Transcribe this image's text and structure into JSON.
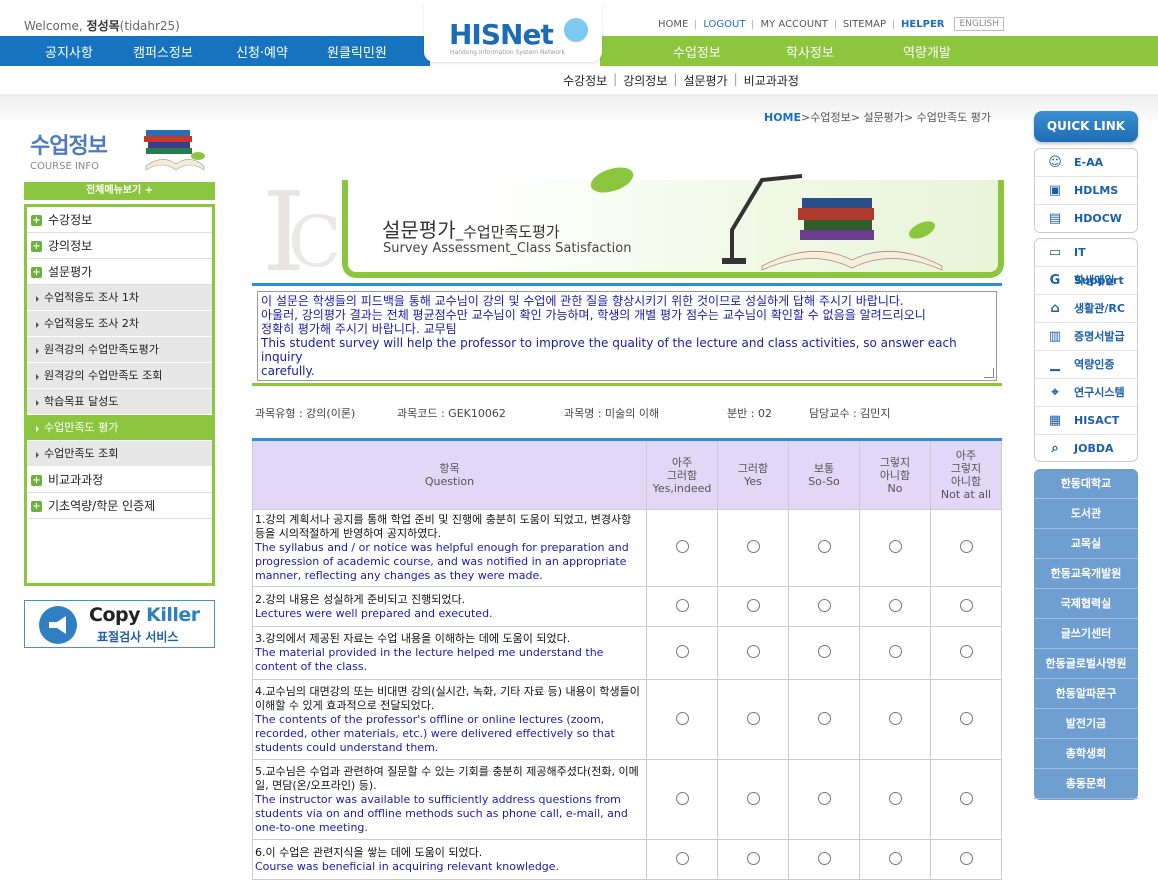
{
  "header": {
    "welcome_prefix": "Welcome,",
    "user_name": "정성목",
    "user_id": "(tidahr25)",
    "logo_text_a": "HIS",
    "logo_text_b": "Net",
    "logo_sub": "Handong Information System Network",
    "links": {
      "home": "HOME",
      "logout": "LOGOUT",
      "account": "MY ACCOUNT",
      "sitemap": "SITEMAP",
      "helper": "HELPER",
      "english": "ENGLISH"
    }
  },
  "nav": {
    "left": [
      "공지사항",
      "캠퍼스정보",
      "신청·예약",
      "원클릭민원"
    ],
    "right": [
      "수업정보",
      "학사정보",
      "역량개발"
    ],
    "sub": [
      "수강정보",
      "강의정보",
      "설문평가",
      "비교과과정"
    ]
  },
  "sidebar": {
    "title": "수업정보",
    "title_en": "COURSE INFO",
    "all_menu": "전체메뉴보기 +",
    "items": [
      {
        "label": "수강정보",
        "type": "top"
      },
      {
        "label": "강의정보",
        "type": "top"
      },
      {
        "label": "설문평가",
        "type": "top"
      },
      {
        "label": "수업적응도 조사 1차",
        "type": "sub"
      },
      {
        "label": "수업적응도 조사 2차",
        "type": "sub"
      },
      {
        "label": "원격강의 수업만족도평가",
        "type": "sub"
      },
      {
        "label": "원격강의 수업만족도 조회",
        "type": "sub"
      },
      {
        "label": "학습목표 달성도",
        "type": "sub"
      },
      {
        "label": "수업만족도 평가",
        "type": "sub",
        "active": true
      },
      {
        "label": "수업만족도 조회",
        "type": "sub"
      },
      {
        "label": "비교과과정",
        "type": "top"
      },
      {
        "label": "기초역량/학문 인증제",
        "type": "top"
      }
    ],
    "copykiller": {
      "title_a": "Copy ",
      "title_b": "Killer",
      "subtitle": "표절검사 서비스"
    }
  },
  "breadcrumb": {
    "home": "HOME",
    "path": ">수업정보> 설문평가> 수업만족도 평가"
  },
  "banner": {
    "title": "설문평가",
    "title_small": "_수업만족도평가",
    "subtitle": "Survey Assessment_Class Satisfaction"
  },
  "notice": {
    "lines": [
      "이 설문은 학생들의 피드백을 통해 교수님이 강의 및 수업에 관한 질을 향상시키기 위한 것이므로 성실하게 답해 주시기 바랍니다.",
      "아울러, 강의평가 결과는 전체 평균점수만 교수님이 확인 가능하며, 학생의 개별 평가 점수는 교수님이 확인할 수 없음을 알려드리오니",
      "정확히 평가해 주시기 바랍니다. 교무팀",
      "This student survey will help the professor to improve the quality of the lecture and class activities, so answer each inquiry",
      "carefully."
    ]
  },
  "course": {
    "type": "과목유형 : 강의(이론)",
    "code": "과목코드 : GEK10062",
    "name": "과목명 : 미술의 이해",
    "section": "분반 : 02",
    "professor": "담당교수 : 김민지"
  },
  "survey": {
    "headers": [
      {
        "ko": "항목",
        "en": "Question"
      },
      {
        "ko": "아주\n그러함",
        "en": "Yes,indeed"
      },
      {
        "ko": "그러함",
        "en": "Yes"
      },
      {
        "ko": "보통",
        "en": "So-So"
      },
      {
        "ko": "그렇지\n아니함",
        "en": "No"
      },
      {
        "ko": "아주\n그렇지\n아니함",
        "en": "Not at all"
      }
    ],
    "questions": [
      {
        "ko": "1.강의 계획서나 공지를 통해 학업 준비 및 진행에 충분히 도움이 되었고, 변경사항 등을 시의적절하게 반영하여 공지하였다.",
        "en": "The syllabus and / or notice was helpful enough for preparation and progression of academic course, and was notified in an appropriate manner, reflecting any changes as they were made."
      },
      {
        "ko": "2.강의 내용은 성실하게 준비되고 진행되었다.",
        "en": "Lectures were well prepared and executed."
      },
      {
        "ko": "3.강의에서 제공된 자료는 수업 내용을 이해하는 데에 도움이 되었다.",
        "en": "The material provided in the lecture helped me understand the content of the class."
      },
      {
        "ko": "4.교수님의 대면강의 또는 비대면 강의(실시간, 녹화, 기타 자료 등) 내용이 학생들이 이해할 수 있게 효과적으로 전달되었다.",
        "en": "The contents of the professor's offline or online lectures (zoom, recorded, other materials, etc.) were delivered effectively so that students could understand them."
      },
      {
        "ko": "5.교수님은 수업과 관련하여 질문할 수 있는 기회를 충분히 제공해주셨다(전화, 이메일, 면담(온/오프라인) 등).",
        "en": "The instructor was available to sufficiently address questions from students via on and offline methods such as phone call, e-mail, and one-to-one meeting."
      },
      {
        "ko": "6.이 수업은 관련지식을 쌓는 데에 도움이 되었다.",
        "en": "Course was beneficial in acquiring relevant knowledge."
      }
    ]
  },
  "quicklink": {
    "title": "QUICK LINK",
    "group1": [
      {
        "label": "E-AA",
        "icon": "person-icon"
      },
      {
        "label": "HDLMS",
        "icon": "board-icon"
      },
      {
        "label": "HDOCW",
        "icon": "document-icon"
      }
    ],
    "group2": [
      {
        "label": "IT Support",
        "icon": "monitor-icon"
      },
      {
        "label": "학생메일",
        "icon": "google-icon"
      },
      {
        "label": "생활관/RC",
        "icon": "home-icon"
      },
      {
        "label": "증명서발급",
        "icon": "printer-icon"
      },
      {
        "label": "역량인증",
        "icon": "chart-icon"
      },
      {
        "label": "연구시스템",
        "icon": "microscope-icon"
      },
      {
        "label": "HISACT",
        "icon": "clipboard-icon"
      },
      {
        "label": "JOBDA",
        "icon": "search-icon"
      }
    ],
    "blue": [
      "한동대학교",
      "도서관",
      "교목실",
      "한동교육개발원",
      "국제협력실",
      "글쓰기센터",
      "한동글로벌사명원",
      "한동알파문구",
      "발전기금",
      "총학생회",
      "총동문회"
    ]
  }
}
